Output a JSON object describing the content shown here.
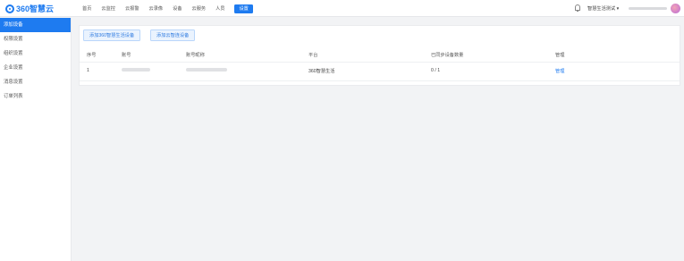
{
  "brand": {
    "logo_text": "360智慧云"
  },
  "nav": {
    "items": [
      {
        "label": "首页",
        "active": false
      },
      {
        "label": "云监控",
        "active": false
      },
      {
        "label": "云报警",
        "active": false
      },
      {
        "label": "云录像",
        "active": false
      },
      {
        "label": "设备",
        "active": false
      },
      {
        "label": "云服务",
        "active": false
      },
      {
        "label": "人员",
        "active": false
      },
      {
        "label": "设置",
        "active": true
      }
    ]
  },
  "header": {
    "account_label": "智慧生活测试 ▾"
  },
  "sidebar": {
    "items": [
      {
        "label": "添加设备",
        "active": true
      },
      {
        "label": "权限设置",
        "active": false
      },
      {
        "label": "组织设置",
        "active": false
      },
      {
        "label": "企业设置",
        "active": false
      },
      {
        "label": "消息设置",
        "active": false
      },
      {
        "label": "订单列表",
        "active": false
      }
    ]
  },
  "actions": {
    "add_360_label": "添加360智慧生活设备",
    "add_cloud_label": "添加云智连设备"
  },
  "table": {
    "columns": [
      "序号",
      "账号",
      "账号昵称",
      "平台",
      "已同步设备数量",
      "管理"
    ],
    "rows": [
      {
        "index": "1",
        "account": "",
        "nickname": "",
        "platform": "360智慧生活",
        "synced": "0 / 1",
        "manage": "管理"
      }
    ]
  },
  "colors": {
    "accent": "#1e7bf0",
    "background": "#f2f3f5"
  }
}
